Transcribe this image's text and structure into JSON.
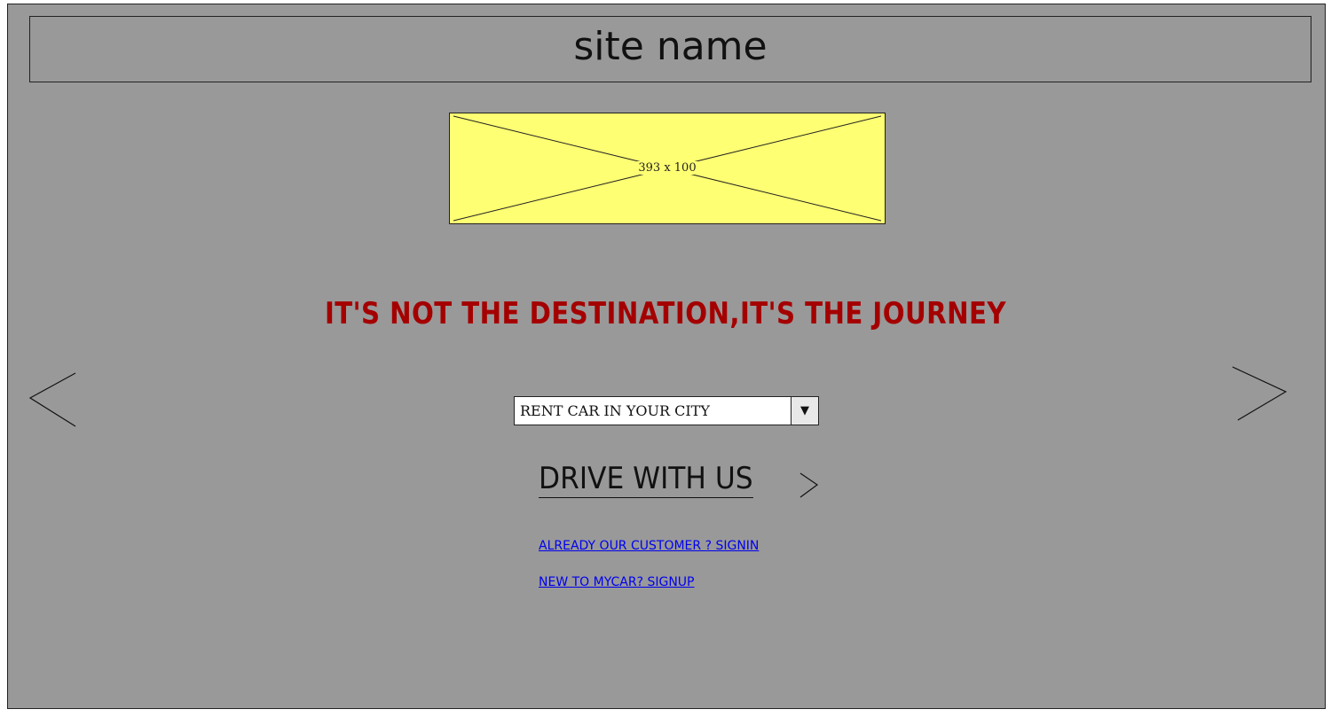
{
  "header": {
    "site_name": "site name"
  },
  "hero_image": {
    "label": "393 x 100",
    "fill_color": "#ffff73"
  },
  "tagline": {
    "text": "IT'S NOT THE DESTINATION,IT'S THE JOURNEY",
    "color": "#a50000"
  },
  "carousel": {
    "prev_icon": "chevron-left-icon",
    "next_icon": "chevron-right-icon"
  },
  "city_select": {
    "selected": "RENT CAR IN YOUR CITY",
    "dropdown_glyph": "▼"
  },
  "cta": {
    "label": "DRIVE WITH US",
    "icon": "chevron-right-icon"
  },
  "links": {
    "signin": "ALREADY OUR CUSTOMER ? SIGNIN",
    "signup": "NEW TO MYCAR? SIGNUP",
    "color": "#0000ee"
  },
  "colors": {
    "background": "#999999"
  }
}
